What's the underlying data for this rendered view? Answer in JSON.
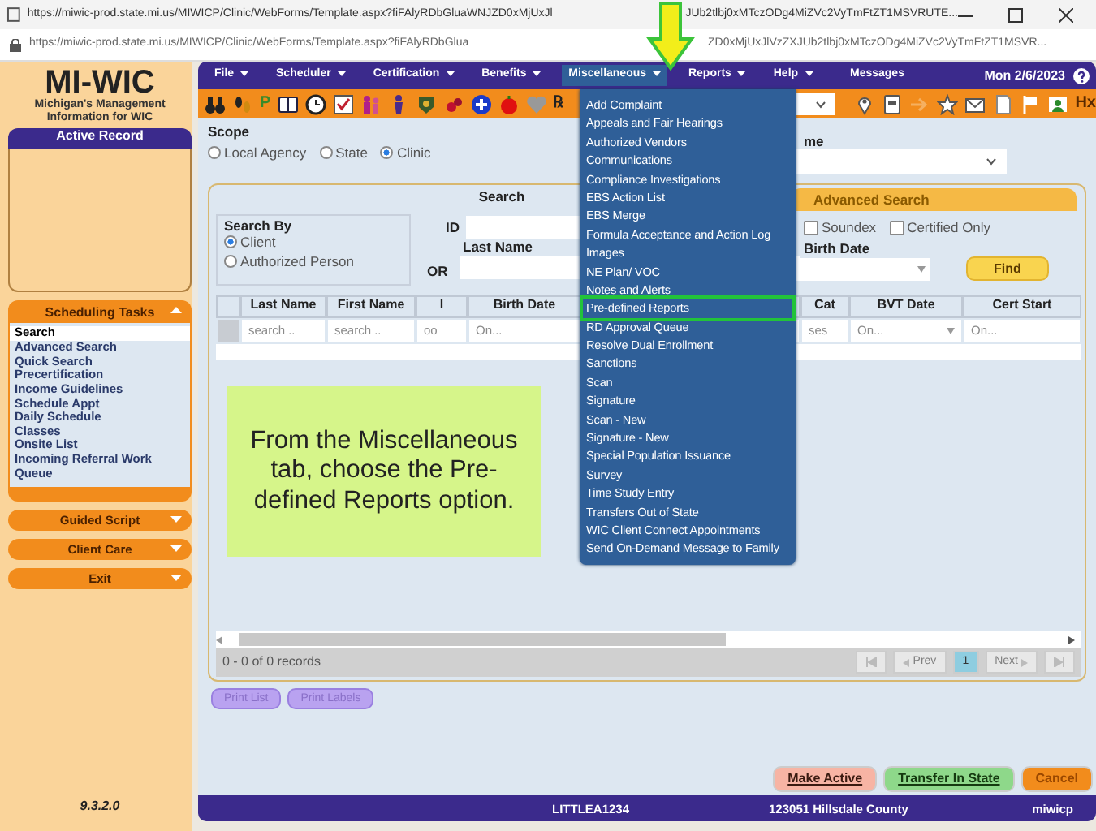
{
  "browser": {
    "title_parts": [
      "https://miwic-prod.state.mi.us/MIWICP/Clinic/WebForms/Template.aspx?fiFAlyRDbGluaWNJZD0xMjUxJl",
      "JUb2tlbj0xMTczODg4MiZVc2VyTmFtZT1MSVRUTE..."
    ],
    "address_parts": [
      "https://miwic-prod.state.mi.us/MIWICP/Clinic/WebForms/Template.aspx?fiFAlyRDbGlua",
      "ZD0xMjUxJlVzZXJUb2tlbj0xMTczODg4MiZVc2VyTmFtZT1MSVR..."
    ]
  },
  "sidebar": {
    "logo": "MI-WIC",
    "subtitle": "Michigan's Management Information for WIC",
    "active_record": "Active Record",
    "task_panel": {
      "title": "Scheduling Tasks",
      "expanded": true,
      "items": [
        {
          "label": "Search",
          "selected": true
        },
        {
          "label": "Advanced Search",
          "selected": false
        },
        {
          "label": "Quick Search",
          "selected": false
        },
        {
          "label": "Precertification",
          "selected": false
        },
        {
          "label": "Income Guidelines",
          "selected": false
        },
        {
          "label": "Schedule Appt",
          "selected": false
        },
        {
          "label": "Daily Schedule",
          "selected": false
        },
        {
          "label": "Classes",
          "selected": false
        },
        {
          "label": "Onsite List",
          "selected": false
        },
        {
          "label": "Incoming Referral Work Queue",
          "selected": false
        }
      ]
    },
    "sections": [
      {
        "label": "Guided Script",
        "expanded": false
      },
      {
        "label": "Client Care",
        "expanded": false
      },
      {
        "label": "Exit",
        "expanded": false
      }
    ],
    "version": "9.3.2.0"
  },
  "menubar": {
    "items": [
      {
        "label": "File",
        "kind": "dropdown",
        "selected": false
      },
      {
        "label": "Scheduler",
        "kind": "dropdown",
        "selected": false
      },
      {
        "label": "Certification",
        "kind": "dropdown",
        "selected": false
      },
      {
        "label": "Benefits",
        "kind": "dropdown",
        "selected": false
      },
      {
        "label": "Miscellaneous",
        "kind": "dropdown",
        "selected": true
      },
      {
        "label": "Reports",
        "kind": "dropdown",
        "selected": false
      },
      {
        "label": "Help",
        "kind": "dropdown",
        "selected": false
      },
      {
        "label": "Messages",
        "kind": "link",
        "selected": false
      }
    ],
    "date": "Mon 2/6/2023"
  },
  "toolbar": {
    "letter": "P",
    "rx": "℞",
    "hx": "Hx"
  },
  "dropdown": {
    "items": [
      {
        "label": "Add Complaint",
        "highlighted": false
      },
      {
        "label": "Appeals and Fair Hearings",
        "highlighted": false
      },
      {
        "label": "Authorized Vendors",
        "highlighted": false
      },
      {
        "label": "Communications",
        "highlighted": false
      },
      {
        "label": "Compliance Investigations",
        "highlighted": false
      },
      {
        "label": "EBS Action List",
        "highlighted": false
      },
      {
        "label": "EBS Merge",
        "highlighted": false
      },
      {
        "label": "Formula Acceptance and Action Log",
        "highlighted": false
      },
      {
        "label": "Images",
        "highlighted": false
      },
      {
        "label": "NE Plan/ VOC",
        "highlighted": false
      },
      {
        "label": "Notes and Alerts",
        "highlighted": false
      },
      {
        "label": "Pre-defined Reports",
        "highlighted": true
      },
      {
        "label": "RD Approval Queue",
        "highlighted": false
      },
      {
        "label": "Resolve Dual Enrollment",
        "highlighted": false
      },
      {
        "label": "Sanctions",
        "highlighted": false
      },
      {
        "label": "Scan",
        "highlighted": false
      },
      {
        "label": "Signature",
        "highlighted": false
      },
      {
        "label": "Scan - New",
        "highlighted": false
      },
      {
        "label": "Signature - New",
        "highlighted": false
      },
      {
        "label": "Special Population Issuance",
        "highlighted": false
      },
      {
        "label": "Survey",
        "highlighted": false
      },
      {
        "label": "Time Study Entry",
        "highlighted": false
      },
      {
        "label": "Transfers Out of State",
        "highlighted": false
      },
      {
        "label": "WIC Client Connect Appointments",
        "highlighted": false
      },
      {
        "label": "Send On-Demand Message to Family",
        "highlighted": false
      }
    ]
  },
  "scope": {
    "title": "Scope",
    "options": [
      {
        "label": "Local Agency",
        "selected": false
      },
      {
        "label": "State",
        "selected": false
      },
      {
        "label": "Clinic",
        "selected": true
      }
    ],
    "name_label": "me"
  },
  "search": {
    "tabs": [
      {
        "label": "Search",
        "selected": true
      },
      {
        "label": "Advanced Search",
        "selected": false
      }
    ],
    "search_by": {
      "title": "Search By",
      "options": [
        {
          "label": "Client",
          "selected": true
        },
        {
          "label": "Authorized Person",
          "selected": false
        }
      ]
    },
    "id_label": "ID",
    "last_name_label": "Last Name",
    "or_label": "OR",
    "checks": [
      {
        "label": "Soundex",
        "checked": false
      },
      {
        "label": "Certified Only",
        "checked": false
      }
    ],
    "birth_date_label": "Birth Date",
    "find": "Find"
  },
  "grid": {
    "columns": [
      {
        "label": "Last Name",
        "filter": "search .."
      },
      {
        "label": "First Name",
        "filter": "search .."
      },
      {
        "label": "I",
        "filter": "oo"
      },
      {
        "label": "Birth Date",
        "filter": "On..."
      },
      {
        "label": "Cat",
        "filter": "ses"
      },
      {
        "label": "BVT Date",
        "filter": "On..."
      },
      {
        "label": "Cert Start",
        "filter": "On..."
      }
    ],
    "records": "0 - 0 of 0 records",
    "pager": {
      "prev": "Prev",
      "page": "1",
      "next": "Next"
    }
  },
  "print_buttons": [
    {
      "label": "Print List",
      "disabled": true
    },
    {
      "label": "Print Labels",
      "disabled": true
    }
  ],
  "actions": [
    {
      "label": "Make Active",
      "kind": "activate",
      "disabled": false
    },
    {
      "label": "Transfer In State",
      "kind": "transfer",
      "disabled": false
    },
    {
      "label": "Cancel",
      "kind": "cancel",
      "disabled": true
    }
  ],
  "callout": "From the Miscellaneous tab, choose the Pre-defined Reports option.",
  "status_bar": [
    "LITTLEA1234",
    "123051 Hillsdale County",
    "miwicp"
  ]
}
